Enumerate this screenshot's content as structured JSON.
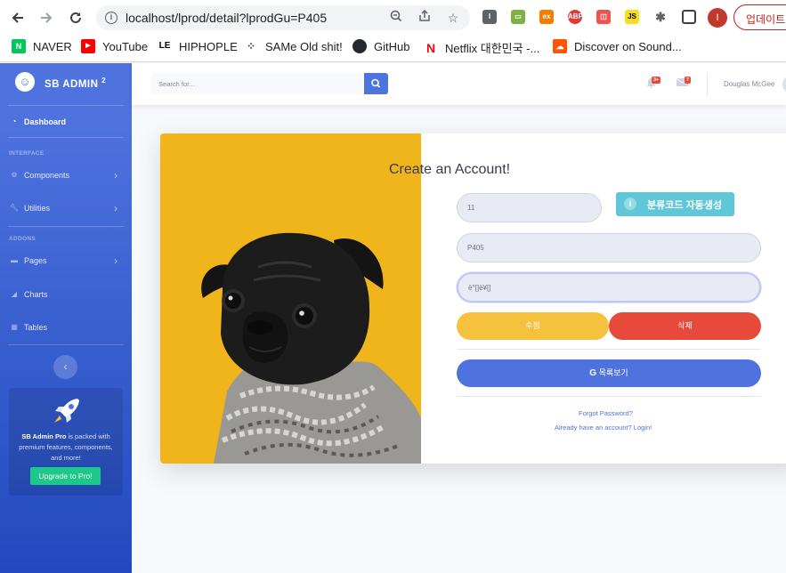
{
  "browser": {
    "url": "localhost/lprod/detail?lprodGu=P405",
    "update_label": "업데이트",
    "profile_initial": "I",
    "bookmarks": [
      {
        "label": "NAVER",
        "icon": "naver-icon",
        "color": "#03c75a",
        "glyph": "N"
      },
      {
        "label": "YouTube",
        "icon": "youtube-icon",
        "color": "#ff0000",
        "glyph": "▶"
      },
      {
        "label": "HIPHOPLE",
        "icon": "hiphople-icon",
        "color": "#000000",
        "glyph": "LE"
      },
      {
        "label": "SAMe Old shit!",
        "icon": "same-icon",
        "color": "#333333",
        "glyph": "⁘"
      },
      {
        "label": "GitHub",
        "icon": "github-icon",
        "color": "#24292e",
        "glyph": "●"
      },
      {
        "label": "Netflix 대한민국 -...",
        "icon": "netflix-icon",
        "color": "#e50914",
        "glyph": "N"
      },
      {
        "label": "Discover on Sound...",
        "icon": "soundcloud-icon",
        "color": "#ff5500",
        "glyph": "☁"
      }
    ]
  },
  "sidebar": {
    "brand": "SB ADMIN",
    "brand_sup": "2",
    "dashboard": "Dashboard",
    "heading_interface": "INTERFACE",
    "components": "Components",
    "utilities": "Utilities",
    "heading_addons": "ADDONS",
    "pages": "Pages",
    "charts": "Charts",
    "tables": "Tables",
    "promo_brand": "SB Admin Pro",
    "promo_text": " is packed with premium features, components, and more!",
    "promo_button": "Upgrade to Pro!"
  },
  "topbar": {
    "search_placeholder": "Search for...",
    "alerts_badge": "3+",
    "messages_badge": "7",
    "user_name": "Douglas McGee"
  },
  "form": {
    "title": "Create an Account!",
    "id_value": "11",
    "code_button": "분류코드 자동생성",
    "code_value": "P405",
    "name_value": "ë°[]ë¥[]",
    "edit_button": "수정",
    "delete_button": "삭제",
    "list_button": "목록보기",
    "forgot_link": "Forgot Password?",
    "login_link": "Already have an account? Login!"
  },
  "colors": {
    "primary": "#4e73df",
    "warning": "#f6c23e",
    "danger": "#e74a3b",
    "info": "#5fc7d8",
    "success": "#1cc88a",
    "dog_bg": "#efb51a"
  }
}
